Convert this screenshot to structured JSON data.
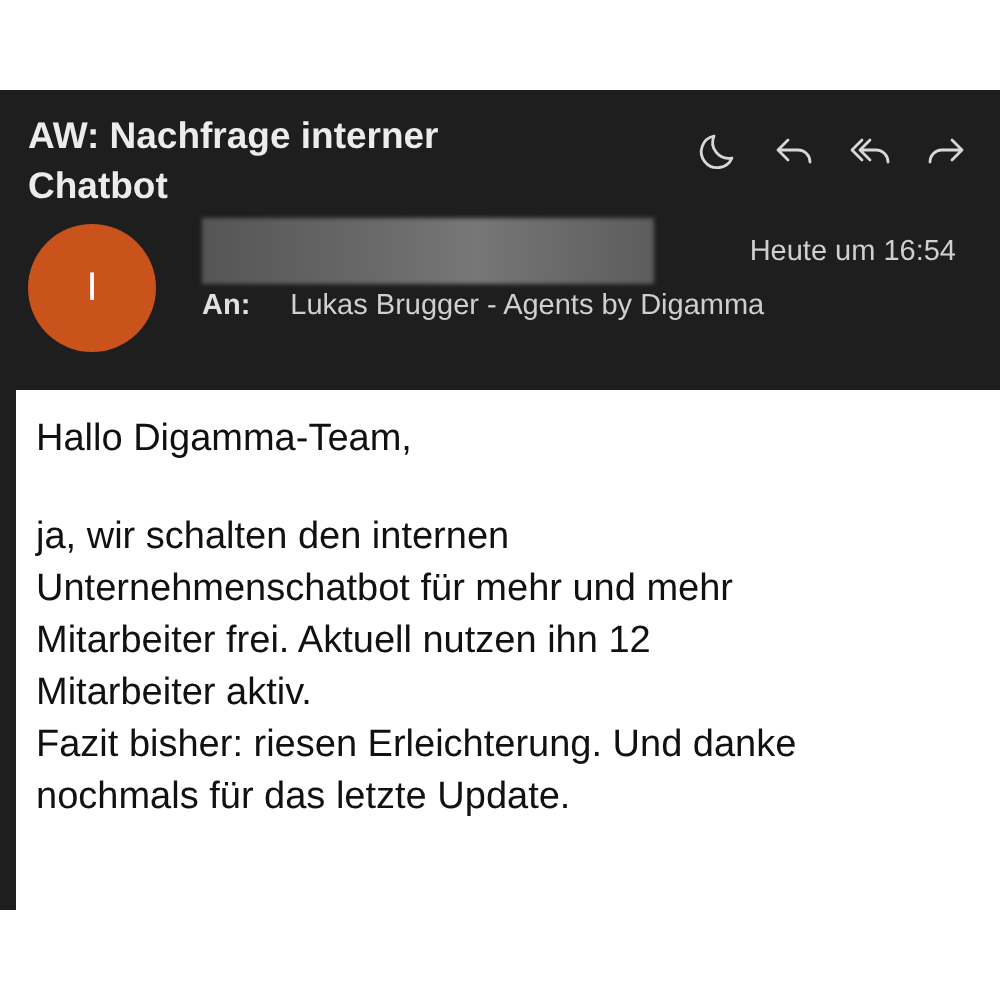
{
  "message": {
    "subject": "AW: Nachfrage interner Chatbot",
    "avatar_initial": "I",
    "time": "Heute um 16:54",
    "to_label": "An:",
    "to": "Lukas Brugger - Agents by Digamma"
  },
  "body": {
    "paragraphs": [
      [
        "Hallo Digamma-Team,"
      ],
      [
        "ja, wir schalten den internen",
        "Unternehmenschatbot für mehr und mehr",
        "Mitarbeiter frei. Aktuell nutzen ihn 12",
        "Mitarbeiter aktiv.",
        "Fazit bisher: riesen Erleichterung. Und danke",
        "nochmals für das letzte Update."
      ]
    ]
  }
}
